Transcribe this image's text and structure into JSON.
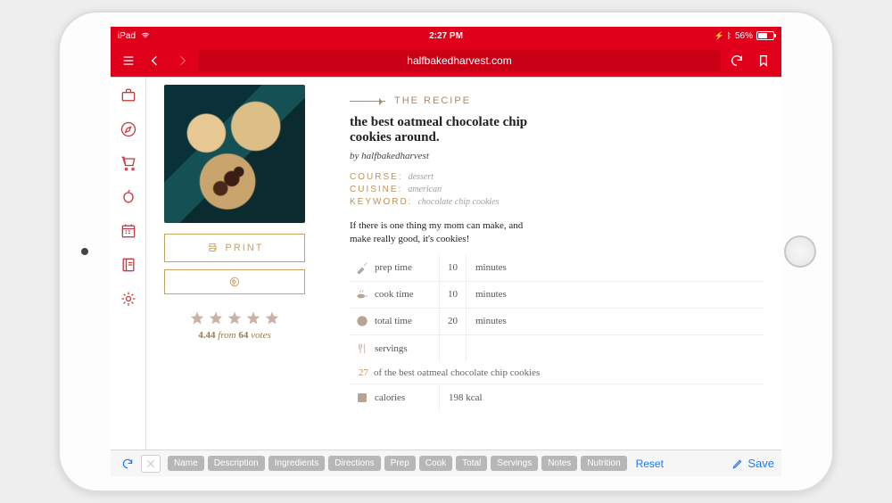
{
  "statusbar": {
    "device": "iPad",
    "time": "2:27 PM",
    "battery_pct": "56%"
  },
  "urlbar": {
    "url": "halfbakedharvest.com"
  },
  "leftcol": {
    "print_label": "PRINT",
    "rating_value": "4.44",
    "rating_from": "from",
    "rating_votes": "64",
    "rating_votes_word": "votes"
  },
  "recipe": {
    "section_label": "THE RECIPE",
    "title": "the best oatmeal chocolate chip cookies around.",
    "byline": "by halfbakedharvest",
    "course_k": "COURSE:",
    "course_v": "dessert",
    "cuisine_k": "CUISINE:",
    "cuisine_v": "american",
    "keyword_k": "KEYWORD:",
    "keyword_v": "chocolate chip cookies",
    "desc": "If there is one thing my mom can make, and make really good, it's cookies!",
    "rows": {
      "prep": {
        "label": "prep time",
        "val": "10",
        "unit": "minutes"
      },
      "cook": {
        "label": "cook time",
        "val": "10",
        "unit": "minutes"
      },
      "total": {
        "label": "total time",
        "val": "20",
        "unit": "minutes"
      },
      "servings": {
        "label": "servings"
      },
      "calories": {
        "label": "calories",
        "val": "198 kcal"
      }
    },
    "serv_detail_num": "27",
    "serv_detail_text": "of the best oatmeal chocolate chip cookies"
  },
  "bottombar": {
    "chips": {
      "name": "Name",
      "desc": "Description",
      "ing": "Ingredients",
      "dir": "Directions",
      "prep": "Prep",
      "cook": "Cook",
      "total": "Total",
      "serv": "Servings",
      "notes": "Notes",
      "nutr": "Nutrition"
    },
    "reset": "Reset",
    "save": "Save"
  }
}
